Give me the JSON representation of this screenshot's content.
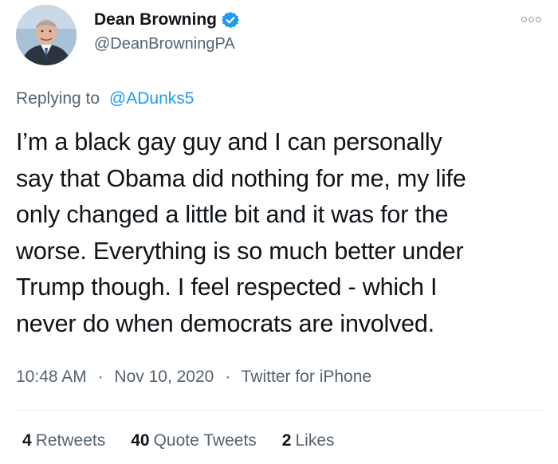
{
  "author": {
    "display_name": "Dean Browning",
    "handle": "@DeanBrowningPA",
    "verified": true
  },
  "reply": {
    "prefix": "Replying to",
    "mention": "@ADunks5"
  },
  "tweet": {
    "text_lines": [
      "I’m a black gay guy and I can personally",
      "say that Obama did nothing for me, my life",
      "only changed a little bit and it was for the",
      "worse. Everything is so much better under",
      "Trump though. I feel respected - which I",
      "never do when democrats are involved."
    ]
  },
  "meta": {
    "time": "10:48 AM",
    "date": "Nov 10, 2020",
    "source": "Twitter for iPhone",
    "separator": "·"
  },
  "stats": {
    "retweets_count": "4",
    "retweets_label": "Retweets",
    "quotes_count": "40",
    "quotes_label": "Quote Tweets",
    "likes_count": "2",
    "likes_label": "Likes"
  },
  "colors": {
    "text_primary": "#0f1419",
    "text_secondary": "#536471",
    "accent": "#1d9bf0",
    "verified_badge": "#1d9bf0",
    "divider": "#e1e8ed"
  },
  "icons": {
    "verified": "verified-badge-icon",
    "more": "more-options-icon"
  }
}
